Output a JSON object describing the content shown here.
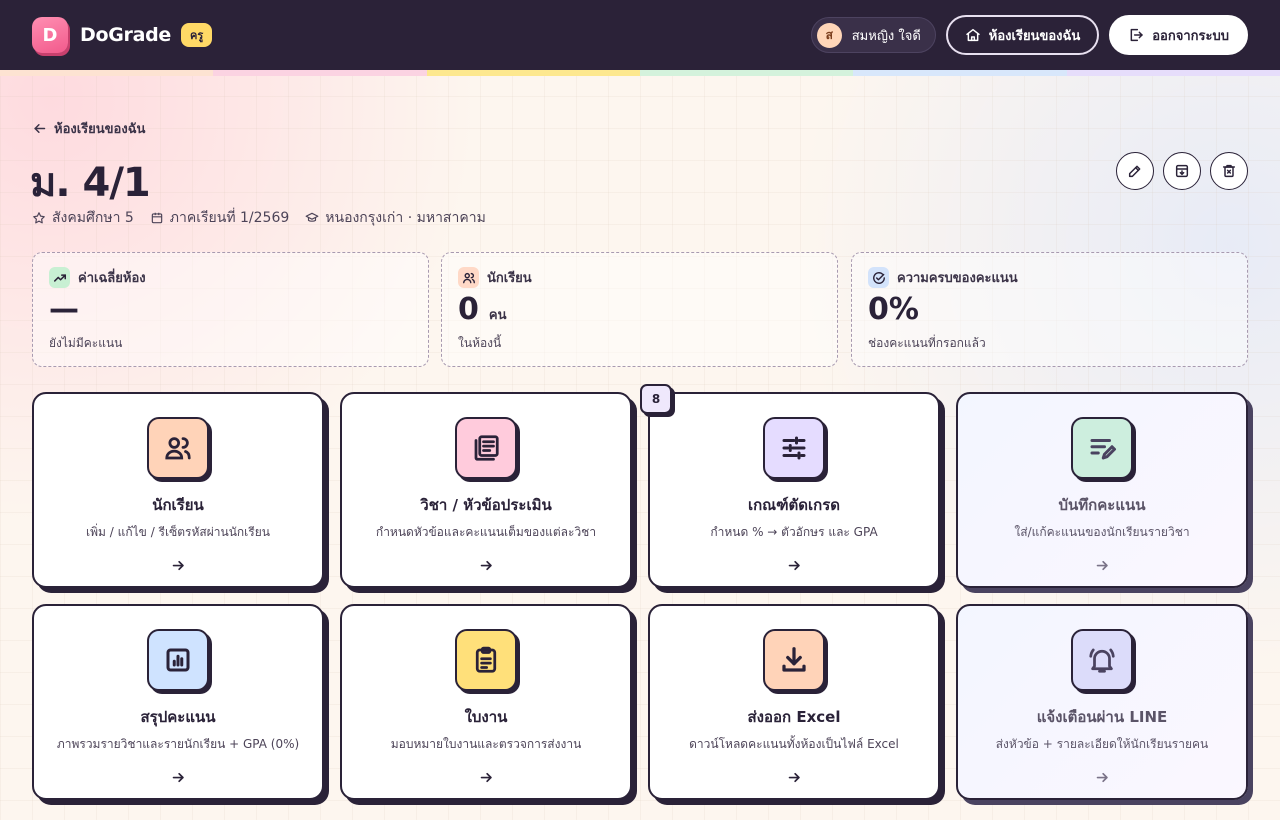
{
  "header": {
    "brand": "DoGrade",
    "role_badge": "ครู",
    "logo_letter": "D",
    "user": {
      "initial": "ส",
      "name": "สมหญิง ใจดี"
    },
    "my_classes_label": "ห้องเรียนของฉัน",
    "logout_label": "ออกจากระบบ",
    "rainbow_colors": [
      "#fde3d2",
      "#fbd3e2",
      "#fde88f",
      "#d4f2dc",
      "#d8e7fb",
      "#e6ddfb"
    ]
  },
  "page": {
    "back_label": "ห้องเรียนของฉัน",
    "title": "ม. 4/1",
    "subject": "สังคมศึกษา 5",
    "term": "ภาคเรียนที่ 1/2569",
    "school": "หนองกรุงเก่า · มหาสาคาม"
  },
  "stats": [
    {
      "label": "ค่าเฉลี่ยห้อง",
      "value": "—",
      "unit": "",
      "sub": "ยังไม่มีคะแนน",
      "icon": "trend-up-icon",
      "color": "#c8f0d3"
    },
    {
      "label": "นักเรียน",
      "value": "0",
      "unit": "คน",
      "sub": "ในห้องนี้",
      "icon": "users-icon",
      "color": "#ffd9c7"
    },
    {
      "label": "ความครบของคะแนน",
      "value": "0%",
      "unit": "",
      "sub": "ช่องคะแนนที่กรอกแล้ว",
      "icon": "check-badge-icon",
      "color": "#d3e3fb"
    }
  ],
  "tiles": [
    {
      "title": "นักเรียน",
      "desc": "เพิ่ม / แก้ไข / รีเซ็ตรหัสผ่านนักเรียน",
      "icon": "users-icon",
      "color": "#ffd3b8"
    },
    {
      "title": "วิชา / หัวข้อประเมิน",
      "desc": "กำหนดหัวข้อและคะแนนเต็มของแต่ละวิชา",
      "icon": "book-icon",
      "color": "#ffcbdc"
    },
    {
      "title": "เกณฑ์ตัดเกรด",
      "desc": "กำหนด % → ตัวอักษร และ GPA",
      "icon": "sliders-icon",
      "color": "#e5dcff",
      "badge": "8"
    },
    {
      "title": "บันทึกคะแนน",
      "desc": "ใส่/แก้คะแนนของนักเรียนรายวิชา",
      "icon": "edit-list-icon",
      "color": "#cdeede"
    },
    {
      "title": "สรุปคะแนน",
      "desc": "ภาพรวมรายวิชาและรายนักเรียน + GPA (0%)",
      "icon": "chart-icon",
      "color": "#cfe3ff"
    },
    {
      "title": "ใบงาน",
      "desc": "มอบหมายใบงานและตรวจการส่งงาน",
      "icon": "clipboard-icon",
      "color": "#ffe07a"
    },
    {
      "title": "ส่งออก Excel",
      "desc": "ดาวน์โหลดคะแนนทั้งห้องเป็นไฟล์ Excel",
      "icon": "download-icon",
      "color": "#ffd3b8"
    },
    {
      "title": "แจ้งเตือนผ่าน LINE",
      "desc": "ส่งหัวข้อ + รายละเอียดให้นักเรียนรายคน",
      "icon": "bell-icon",
      "color": "#dcdcfa"
    }
  ]
}
